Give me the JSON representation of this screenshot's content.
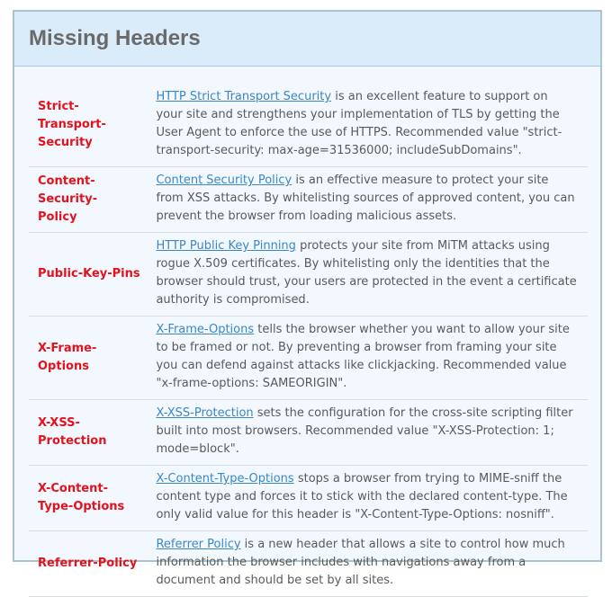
{
  "panel": {
    "title": "Missing Headers"
  },
  "headers": [
    {
      "name": "Strict-Transport-Security",
      "link": "HTTP Strict Transport Security",
      "text": " is an excellent feature to support on your site and strengthens your implementation of TLS by getting the User Agent to enforce the use of HTTPS. Recommended value \"strict-transport-security: max-age=31536000; includeSubDomains\"."
    },
    {
      "name": "Content-Security-Policy",
      "link": "Content Security Policy",
      "text": " is an effective measure to protect your site from XSS attacks. By whitelisting sources of approved content, you can prevent the browser from loading malicious assets."
    },
    {
      "name": "Public-Key-Pins",
      "link": "HTTP Public Key Pinning",
      "text": " protects your site from MiTM attacks using rogue X.509 certificates. By whitelisting only the identities that the browser should trust, your users are protected in the event a certificate authority is compromised."
    },
    {
      "name": "X-Frame-Options",
      "link": "X-Frame-Options",
      "text": " tells the browser whether you want to allow your site to be framed or not. By preventing a browser from framing your site you can defend against attacks like clickjacking. Recommended value \"x-frame-options: SAMEORIGIN\"."
    },
    {
      "name": "X-XSS-Protection",
      "link": "X-XSS-Protection",
      "text": " sets the configuration for the cross-site scripting filter built into most browsers. Recommended value \"X-XSS-Protection: 1; mode=block\"."
    },
    {
      "name": "X-Content-Type-Options",
      "link": "X-Content-Type-Options",
      "text": " stops a browser from trying to MIME-sniff the content type and forces it to stick with the declared content-type. The only valid value for this header is \"X-Content-Type-Options: nosniff\"."
    },
    {
      "name": "Referrer-Policy",
      "link": "Referrer Policy",
      "text": " is a new header that allows a site to control how much information the browser includes with navigations away from a document and should be set by all sites."
    }
  ],
  "colors": {
    "header_name": "#e3121c",
    "link": "#3a87c8",
    "panel_header_bg": "#daebfa",
    "panel_bg": "#f2f8fd"
  }
}
